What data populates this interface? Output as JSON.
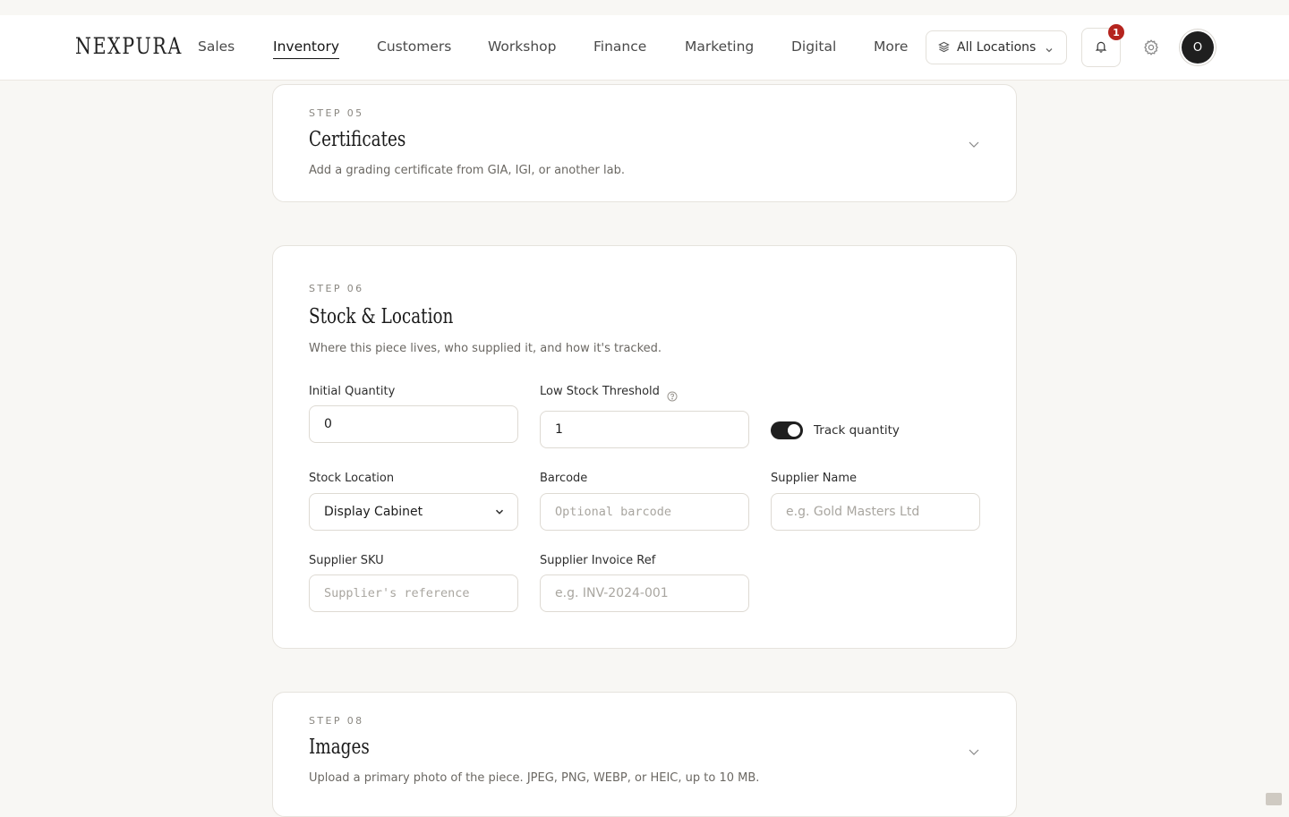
{
  "brand": {
    "logo": "NEXPURA"
  },
  "nav": {
    "items": [
      {
        "label": "Sales"
      },
      {
        "label": "Inventory",
        "active": true
      },
      {
        "label": "Customers"
      },
      {
        "label": "Workshop"
      },
      {
        "label": "Finance"
      },
      {
        "label": "Marketing"
      },
      {
        "label": "Digital"
      },
      {
        "label": "More"
      }
    ],
    "location_select": "All Locations",
    "notification_count": "1",
    "avatar_initial": "O"
  },
  "sections": {
    "certificates": {
      "step": "STEP 05",
      "title": "Certificates",
      "description": "Add a grading certificate from GIA, IGI, or another lab."
    },
    "stock": {
      "step": "STEP 06",
      "title": "Stock & Location",
      "description": "Where this piece lives, who supplied it, and how it's tracked.",
      "fields": {
        "initial_quantity": {
          "label": "Initial Quantity",
          "value": "0"
        },
        "low_stock": {
          "label": "Low Stock Threshold",
          "value": "1"
        },
        "track_quantity": {
          "label": "Track quantity",
          "enabled": true
        },
        "stock_location": {
          "label": "Stock Location",
          "value": "Display Cabinet"
        },
        "barcode": {
          "label": "Barcode",
          "placeholder": "Optional barcode"
        },
        "supplier_name": {
          "label": "Supplier Name",
          "placeholder": "e.g. Gold Masters Ltd"
        },
        "supplier_sku": {
          "label": "Supplier SKU",
          "placeholder": "Supplier's reference"
        },
        "supplier_invoice": {
          "label": "Supplier Invoice Ref",
          "placeholder": "e.g. INV-2024-001"
        }
      }
    },
    "images": {
      "step": "STEP 08",
      "title": "Images",
      "description": "Upload a primary photo of the piece. JPEG, PNG, WEBP, or HEIC, up to 10 MB."
    }
  },
  "colors": {
    "background": "#f8f7f4",
    "card": "#ffffff",
    "accent_dark": "#1f1f1f",
    "badge": "#b5241e"
  }
}
